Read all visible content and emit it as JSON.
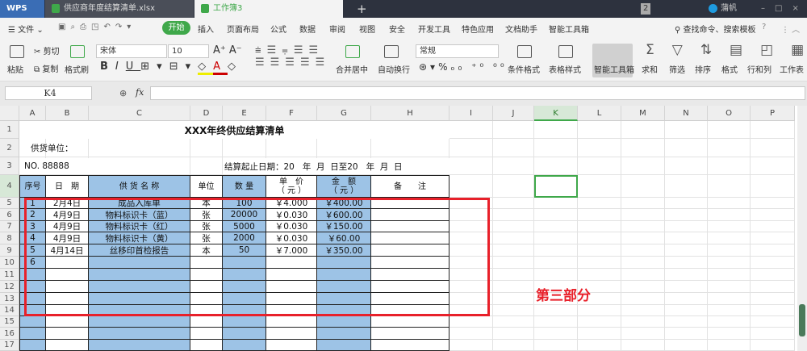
{
  "tabs": {
    "app": "WPS",
    "file1": "供应商年度结算清单.xlsx",
    "file2": "工作簿3",
    "new": "+",
    "badge": "2",
    "user": "蒲帆"
  },
  "menu": {
    "file": "文件",
    "start": "开始",
    "items": [
      "插入",
      "页面布局",
      "公式",
      "数据",
      "审阅",
      "视图",
      "安全",
      "开发工具",
      "特色应用",
      "文档助手",
      "智能工具箱"
    ],
    "search": "查找命令、搜索模板",
    "help": "?"
  },
  "ribbon": {
    "paste": "粘贴",
    "cut": "剪切",
    "copy": "复制",
    "format_painter": "格式刷",
    "font": "宋体",
    "size": "10",
    "merge": "合并居中",
    "wrap": "自动换行",
    "number_format": "常规",
    "cond_format": "条件格式",
    "table_style": "表格样式",
    "smart_tools": "智能工具箱",
    "sum": "求和",
    "filter": "筛选",
    "sort": "排序",
    "format": "格式",
    "rowcol": "行和列",
    "sheet": "工作表"
  },
  "formula": {
    "cell_ref": "K4",
    "fx": "fx",
    "value": ""
  },
  "columns": [
    "A",
    "B",
    "C",
    "D",
    "E",
    "F",
    "G",
    "H",
    "I",
    "J",
    "K",
    "L",
    "M",
    "N",
    "O",
    "P"
  ],
  "rows": [
    "1",
    "2",
    "3",
    "4",
    "5",
    "6",
    "7",
    "8",
    "9",
    "10",
    "11",
    "12",
    "13",
    "14",
    "15",
    "16",
    "17"
  ],
  "sheet": {
    "title": "XXX年终供应结算清单",
    "supplier_label": "供货单位：",
    "no": "NO. 88888",
    "period": "结算起止日期：20   年  月  日至20   年  月  日",
    "headers": [
      "序号",
      "日　期",
      "供 货 名 称",
      "单位",
      "数 量",
      "单　价\n（ 元 ）",
      "金　额\n（ 元 ）",
      "备　　注"
    ],
    "data": [
      [
        "1",
        "2月4日",
        "成品入库单",
        "本",
        "100",
        "￥4.000",
        "￥400.00",
        ""
      ],
      [
        "2",
        "4月9日",
        "物料标识卡（蓝）",
        "张",
        "20000",
        "￥0.030",
        "￥600.00",
        ""
      ],
      [
        "3",
        "4月9日",
        "物料标识卡（红）",
        "张",
        "5000",
        "￥0.030",
        "￥150.00",
        ""
      ],
      [
        "4",
        "4月9日",
        "物料标识卡（黄）",
        "张",
        "2000",
        "￥0.030",
        "￥60.00",
        ""
      ],
      [
        "5",
        "4月14日",
        "丝移印首检报告",
        "本",
        "50",
        "￥7.000",
        "￥350.00",
        ""
      ],
      [
        "6",
        "",
        "",
        "",
        "",
        "",
        "",
        ""
      ]
    ]
  },
  "annotation": {
    "text": "第三部分",
    "color": "#e8202a"
  },
  "colors": {
    "accent": "#3fa84a",
    "header_fill": "#9dc3e6",
    "selection": "#3fa84a"
  }
}
